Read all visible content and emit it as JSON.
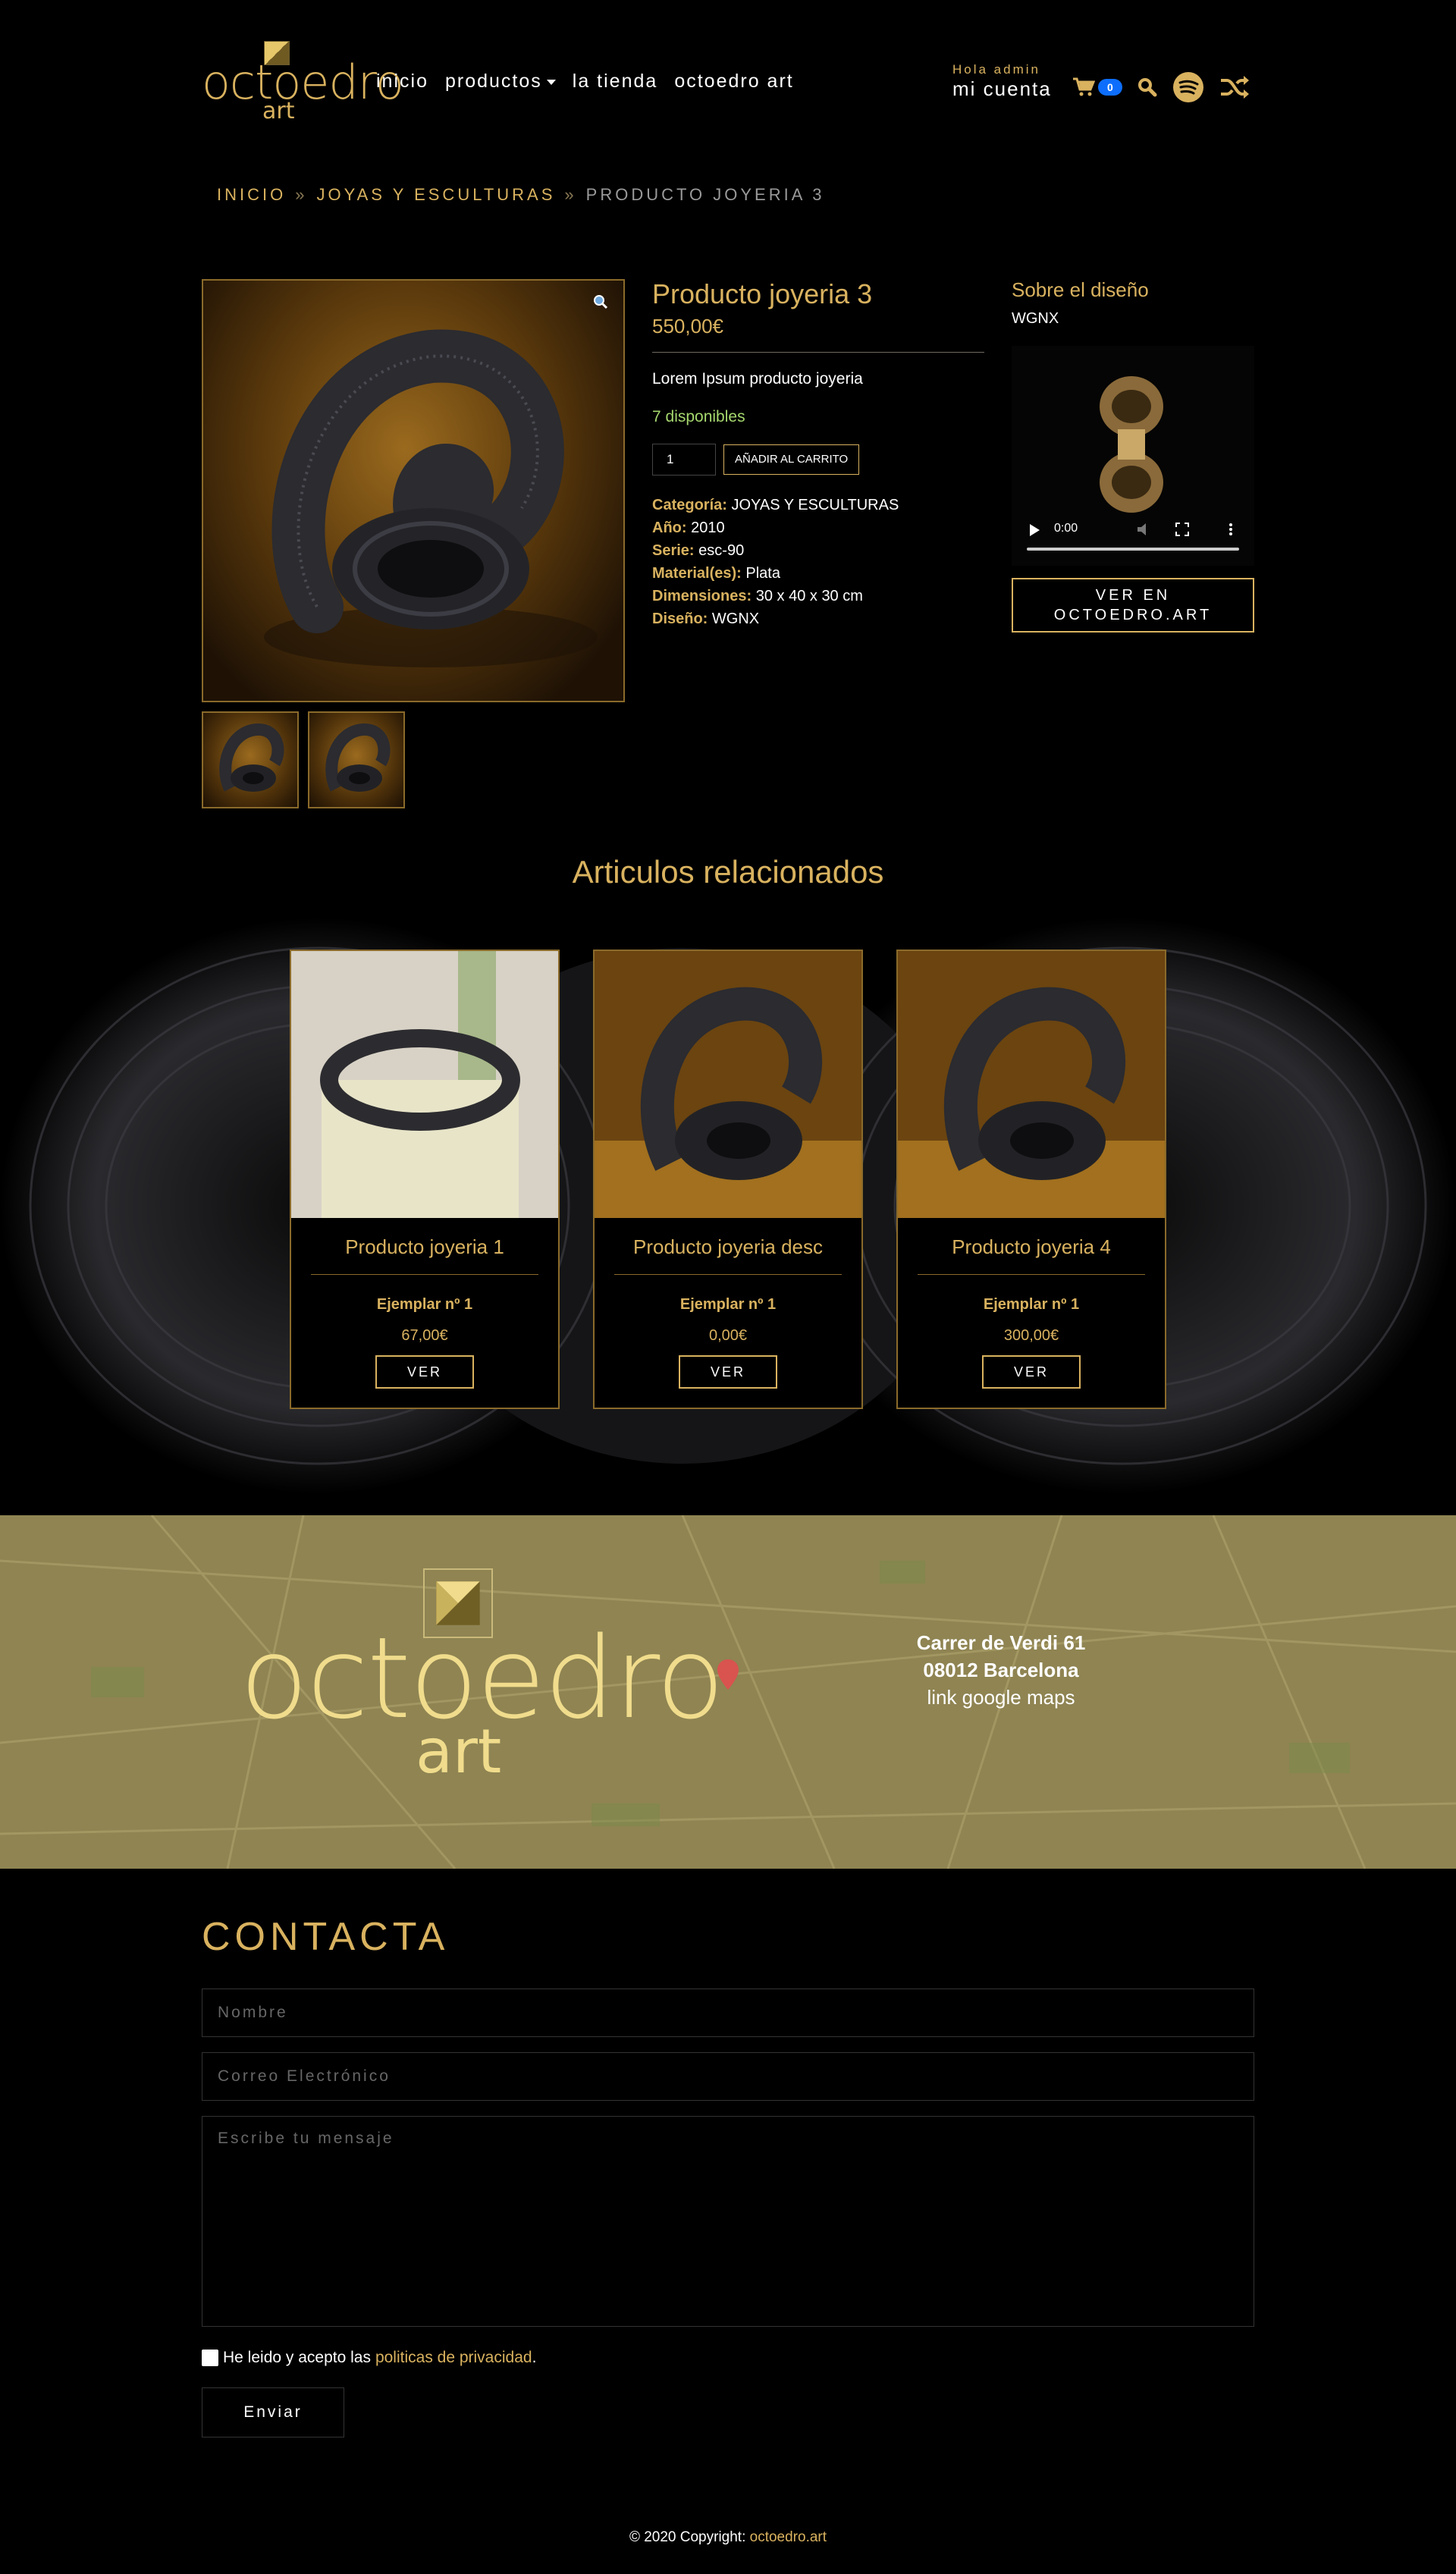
{
  "brand": {
    "word": "octoedro",
    "sub": "art"
  },
  "nav": {
    "items": [
      {
        "label": "inicio"
      },
      {
        "label": "productos"
      },
      {
        "label": "la tienda"
      },
      {
        "label": "octoedro art"
      }
    ]
  },
  "account": {
    "greeting": "Hola admin",
    "link": "mi cuenta"
  },
  "cart": {
    "count": "0"
  },
  "icons": {
    "cart": "cart-icon",
    "search": "search-icon",
    "spotify": "spotify-icon",
    "shuffle": "shuffle-icon",
    "zoom": "zoom-icon"
  },
  "breadcrumb": {
    "home": "INICIO",
    "category": "JOYAS Y ESCULTURAS",
    "current": "PRODUCTO JOYERIA 3",
    "separator": "»"
  },
  "product": {
    "title": "Producto joyeria 3",
    "price": "550,00€",
    "description": "Lorem Ipsum producto joyeria",
    "stock": "7 disponibles",
    "quantity": "1",
    "add_to_cart": "AÑADIR AL CARRITO",
    "meta": [
      {
        "key": "Categoría:",
        "value": "JOYAS Y ESCULTURAS"
      },
      {
        "key": "Año:",
        "value": "2010"
      },
      {
        "key": "Serie:",
        "value": "esc-90"
      },
      {
        "key": "Material(es):",
        "value": "Plata"
      },
      {
        "key": "Dimensiones:",
        "value": "30 x 40 x 30 cm"
      },
      {
        "key": "Diseño:",
        "value": "WGNX"
      }
    ]
  },
  "design": {
    "title": "Sobre el diseño",
    "designer": "WGNX",
    "video_time": "0:00",
    "button_line1": "VER EN",
    "button_line2": "OCTOEDRO.ART"
  },
  "related": {
    "title": "Articulos relacionados",
    "items": [
      {
        "name": "Producto joyeria 1",
        "edition": "Ejemplar nº 1",
        "price": "67,00€",
        "button": "VER"
      },
      {
        "name": "Producto joyeria desc",
        "edition": "Ejemplar nº 1",
        "price": "0,00€",
        "button": "VER"
      },
      {
        "name": "Producto joyeria 4",
        "edition": "Ejemplar nº 1",
        "price": "300,00€",
        "button": "VER"
      }
    ]
  },
  "map": {
    "address1": "Carrer de Verdi 61",
    "address2": "08012 Barcelona",
    "link": "link google maps"
  },
  "contact": {
    "title": "CONTACTA",
    "name_placeholder": "Nombre",
    "email_placeholder": "Correo Electrónico",
    "message_placeholder": "Escribe tu mensaje",
    "consent_text": "He leido y acepto las",
    "consent_link": "politicas de privacidad",
    "consent_end": ".",
    "submit": "Enviar"
  },
  "footer": {
    "text": "© 2020 Copyright:",
    "link": "octoedro.art"
  },
  "colors": {
    "accent": "#d9b25f",
    "background": "#000000",
    "stock": "#a6d86e",
    "badge": "#0d6efd",
    "map": "#8f8452"
  }
}
